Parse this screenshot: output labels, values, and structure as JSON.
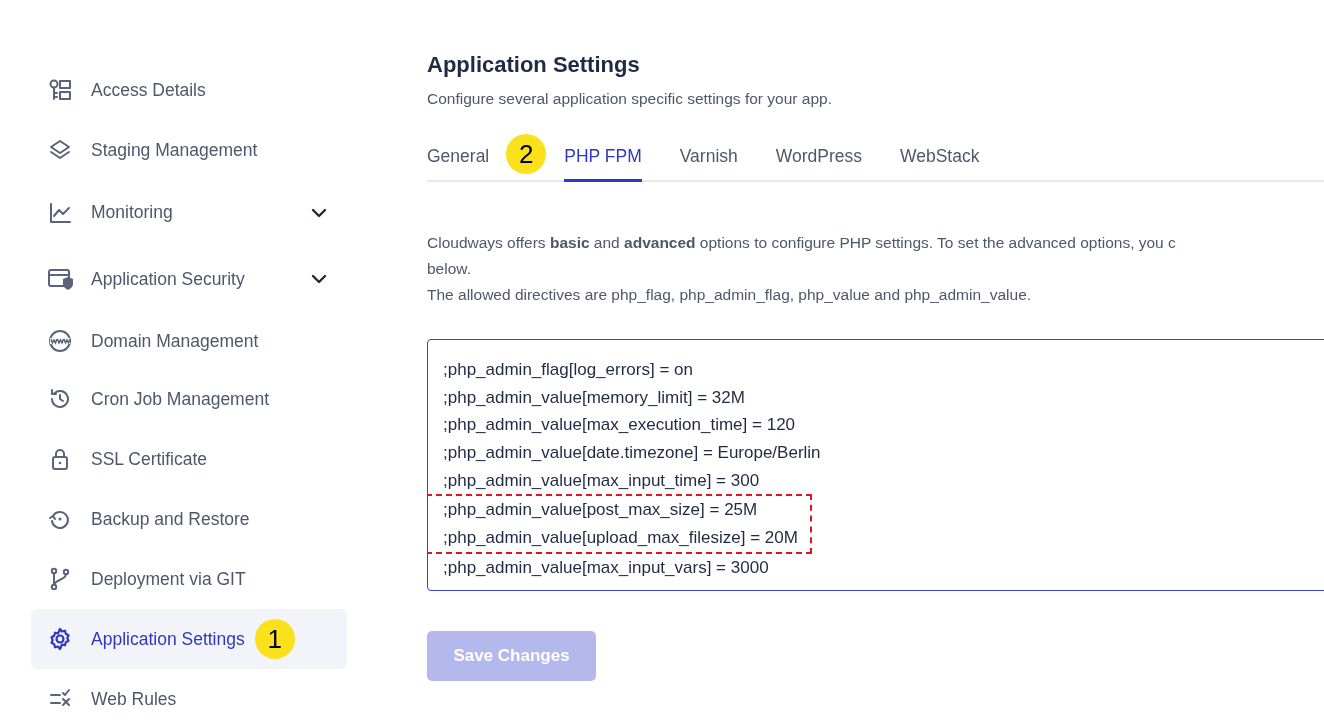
{
  "sidebar": {
    "items": [
      {
        "label": "Access Details",
        "selected": false,
        "chevron": false
      },
      {
        "label": "Staging Management",
        "selected": false,
        "chevron": false
      },
      {
        "label": "Monitoring",
        "selected": false,
        "chevron": true
      },
      {
        "label": "Application Security",
        "selected": false,
        "chevron": true
      },
      {
        "label": "Domain Management",
        "selected": false,
        "chevron": false
      },
      {
        "label": "Cron Job Management",
        "selected": false,
        "chevron": false
      },
      {
        "label": "SSL Certificate",
        "selected": false,
        "chevron": false
      },
      {
        "label": "Backup and Restore",
        "selected": false,
        "chevron": false
      },
      {
        "label": "Deployment via GIT",
        "selected": false,
        "chevron": false
      },
      {
        "label": "Application Settings",
        "selected": true,
        "chevron": false,
        "badge": "1"
      },
      {
        "label": "Web Rules",
        "selected": false,
        "chevron": false
      }
    ]
  },
  "page": {
    "title": "Application Settings",
    "subtitle": "Configure several application specific settings for your app."
  },
  "tabs": [
    {
      "label": "General",
      "selected": false,
      "badge": "2"
    },
    {
      "label": "PHP FPM",
      "selected": true
    },
    {
      "label": "Varnish",
      "selected": false
    },
    {
      "label": "WordPress",
      "selected": false
    },
    {
      "label": "WebStack",
      "selected": false
    }
  ],
  "description": [
    "Cloudways offers **basic** and **advanced** options to configure PHP settings. To set the advanced options, you c",
    "below.",
    "The allowed directives are php_flag, php_admin_flag, php_value and php_admin_value."
  ],
  "editor": {
    "lines": [
      {
        "text": ";php_admin_flag[log_errors] = on",
        "highlighted": false
      },
      {
        "text": ";php_admin_value[memory_limit] = 32M",
        "highlighted": false
      },
      {
        "text": ";php_admin_value[max_execution_time] = 120",
        "highlighted": false
      },
      {
        "text": ";php_admin_value[date.timezone] = Europe/Berlin",
        "highlighted": false
      },
      {
        "text": ";php_admin_value[max_input_time] = 300",
        "highlighted": false
      },
      {
        "text": ";php_admin_value[post_max_size] = 25M",
        "highlighted": true
      },
      {
        "text": ";php_admin_value[upload_max_filesize] = 20M",
        "highlighted": true
      },
      {
        "text": ";php_admin_value[max_input_vars] = 3000",
        "highlighted": false
      }
    ]
  },
  "save_button": {
    "label": "Save Changes",
    "disabled": true
  }
}
